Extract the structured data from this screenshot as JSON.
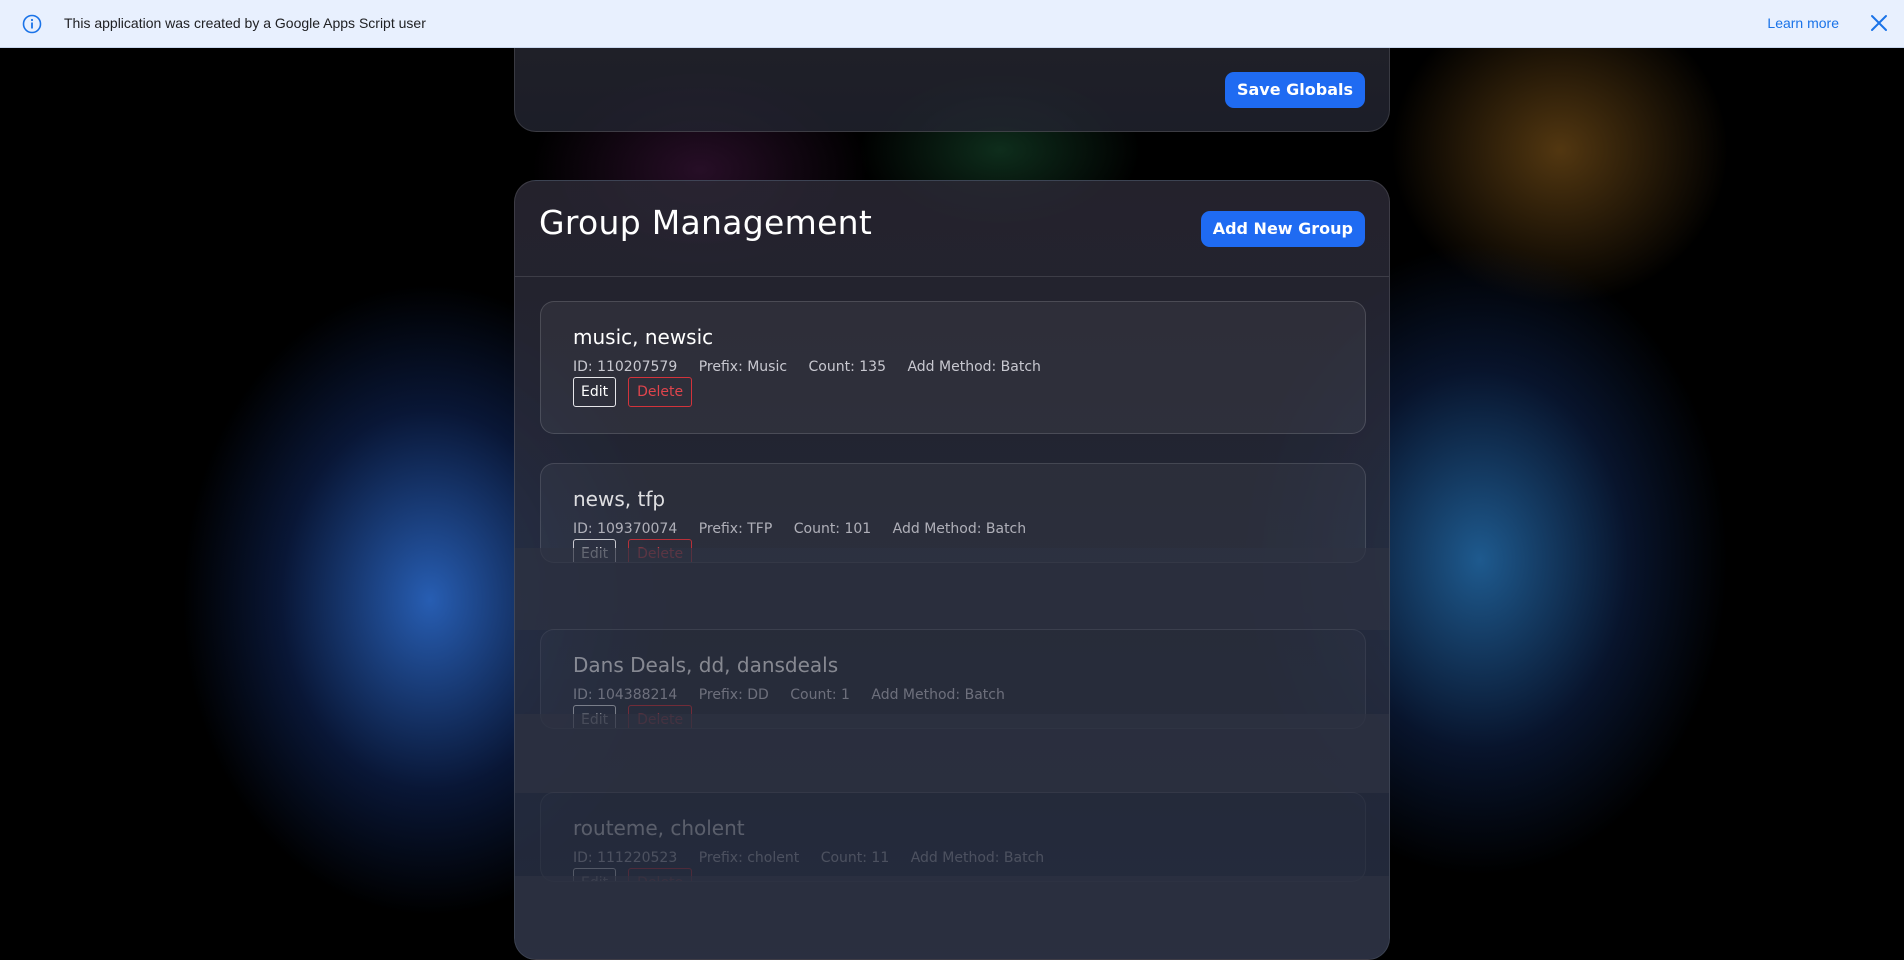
{
  "banner": {
    "message": "This application was created by a Google Apps Script user",
    "learn_more": "Learn more",
    "info_icon": "info-icon",
    "close_icon": "close-icon"
  },
  "globals": {
    "save_label": "Save Globals"
  },
  "group_management": {
    "title": "Group Management",
    "add_label": "Add New Group",
    "groups": [
      {
        "name": "music, newsic",
        "id": "ID: 110207579",
        "prefix": "Prefix: Music",
        "count": "Count: 135",
        "method": "Add Method: Batch",
        "edit": "Edit",
        "delete": "Delete"
      },
      {
        "name": "news, tfp",
        "id": "ID: 109370074",
        "prefix": "Prefix: TFP",
        "count": "Count: 101",
        "method": "Add Method: Batch",
        "edit": "Edit",
        "delete": "Delete"
      },
      {
        "name": "Dans Deals, dd, dansdeals",
        "id": "ID: 104388214",
        "prefix": "Prefix: DD",
        "count": "Count: 1",
        "method": "Add Method: Batch",
        "edit": "Edit",
        "delete": "Delete"
      },
      {
        "name": "routeme, cholent",
        "id": "ID: 111220523",
        "prefix": "Prefix: cholent",
        "count": "Count: 11",
        "method": "Add Method: Batch",
        "edit": "Edit",
        "delete": "Delete"
      }
    ]
  },
  "colors": {
    "accent": "#1f6bf2",
    "danger": "#e0444c",
    "banner_bg": "#e8f0fe",
    "link": "#1a73e8"
  }
}
